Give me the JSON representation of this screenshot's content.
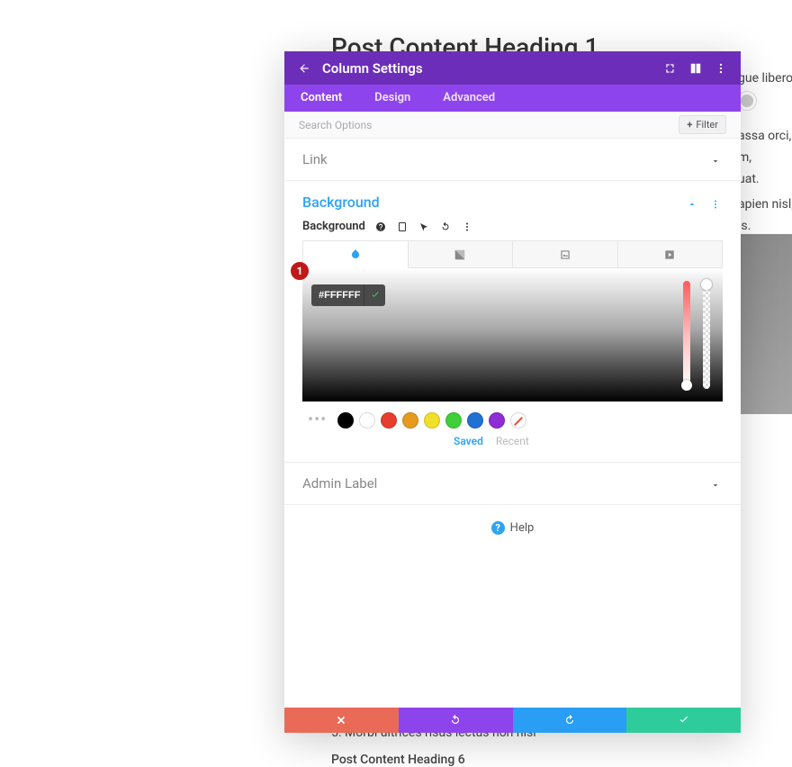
{
  "page": {
    "heading": "Post Content Heading 1",
    "bg_text_a": "gue libero, n",
    "bg_text_b": "assa orci, vi\nm,\nuat.",
    "bg_text_c": "apien nisl, te\nis.",
    "list_item": "5. Morbi ultrices risus lectus non nisl",
    "heading6": "Post Content Heading 6"
  },
  "modal": {
    "title": "Column Settings",
    "tabs": [
      "Content",
      "Design",
      "Advanced"
    ],
    "active_tab": 0,
    "search_placeholder": "Search Options",
    "filter_label": "Filter",
    "sections": {
      "link": {
        "label": "Link"
      },
      "background": {
        "label": "Background",
        "field_label": "Background",
        "hex_value": "#FFFFFF",
        "swatches": [
          "#000000",
          "#ffffff",
          "#e63e2e",
          "#e69b1f",
          "#f0e02a",
          "#3fcf3a",
          "#2071d4",
          "#8e2cd6"
        ],
        "swatch_tabs": {
          "saved": "Saved",
          "recent": "Recent"
        }
      },
      "admin_label": {
        "label": "Admin Label"
      }
    },
    "help_label": "Help",
    "annotation_badge": "1"
  }
}
